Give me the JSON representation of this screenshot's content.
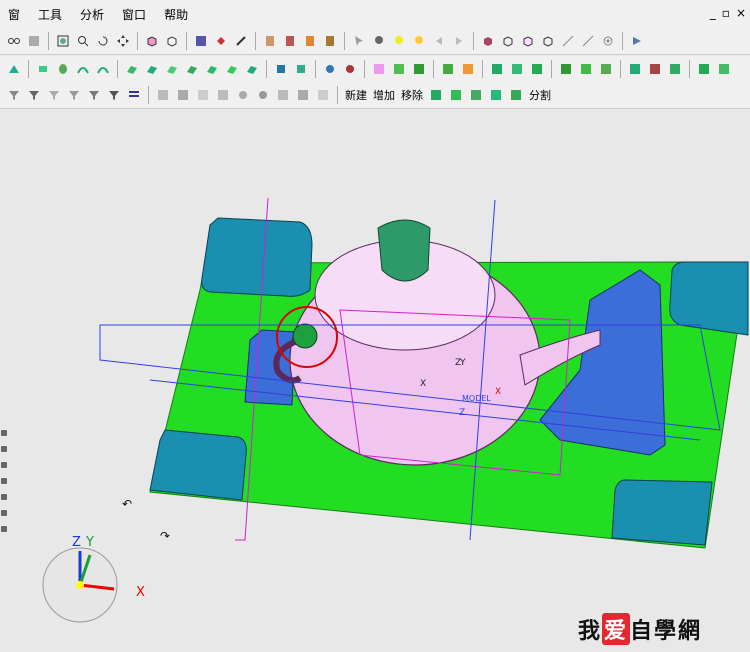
{
  "menubar": {
    "items": [
      "窗",
      "工具",
      "分析",
      "窗口",
      "帮助"
    ],
    "win_min": "_",
    "win_restore": "▫",
    "win_close": "×"
  },
  "toolbar3": {
    "new_label": "新建",
    "add_label": "增加",
    "move_label": "移除",
    "split_label": "分割"
  },
  "viewport": {
    "axis_x": "X",
    "axis_y": "Y",
    "axis_z": "Z",
    "model_label_x": "X",
    "model_label_y": "Y",
    "model_label_z": "Z",
    "model_label_model": "MODEL",
    "model_label_x2": "X",
    "model_label_z2": "Z"
  },
  "colors": {
    "plate": "#22dd22",
    "teapot": "#f0c6f0",
    "handle_block": "#3b6ed8",
    "corner_block": "#1a8fb0",
    "lid": "#2e9a6a",
    "selection_circle": "#e00000"
  },
  "watermark": {
    "part1": "我",
    "heart": "爱",
    "part2": "自學網"
  }
}
